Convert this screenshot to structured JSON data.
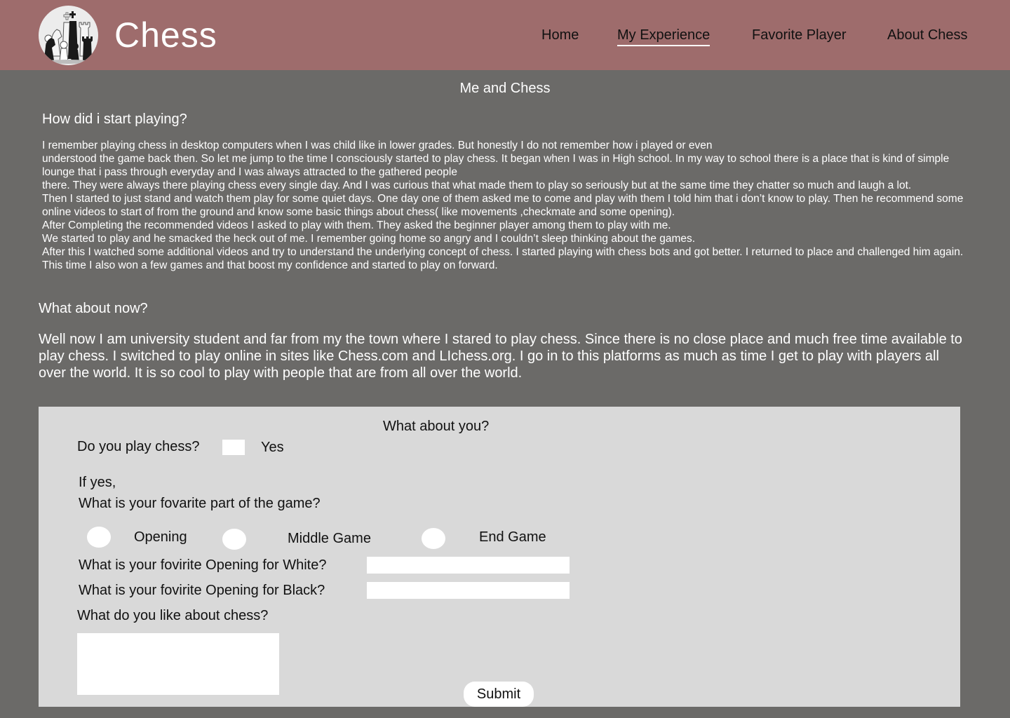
{
  "header": {
    "brand": "Chess",
    "nav": [
      "Home",
      "My Experience",
      "Favorite Player",
      "About Chess"
    ],
    "active_nav": "My Experience",
    "logo_icon": "chess-pieces-icon"
  },
  "main": {
    "title": "Me and Chess",
    "start_heading": "How did i start playing?",
    "story_lines": [
      "I remember playing chess in desktop computers when I was child like in lower grades. But honestly I do not remember how i played or even",
      "understood the game back then. So let me jump to the time I consciously started to play chess. It began when I was in High school. In my way to school there is a place that is kind of simple lounge that i pass through everyday and I was always attracted to the gathered people",
      "there. They were always there playing chess every single day. And I was curious that what made them to play so seriously but at the same time they chatter so much and laugh a lot.",
      "Then I started to just stand and watch them play for some quiet days. One day one of them asked me to come and play with them I told him that i don’t know to play. Then he recommend some online videos to start of from the ground and know some basic things about chess( like movements ,checkmate and some opening).",
      "After Completing the recommended videos I asked to play with them. They asked the beginner player among them to play with me.",
      "We started to play and he smacked the heck out of me. I remember going home so angry and I couldn’t sleep thinking about the games.",
      "After this I watched some additional videos and try to understand the underlying concept of chess. I started playing with chess bots and got better. I returned to place and challenged him again. This time I also won a few games and that boost my confidence and started to play on forward."
    ],
    "now_heading": "What about now?",
    "now_text": "Well now I am university student and far from my the town where I stared to play chess. Since there is no close place and much free time available to play chess. I switched to play online in sites like Chess.com and LIchess.org. I go in to this platforms as much as time I get to play with players all over the world. It is so cool to play with people that are from all over the world."
  },
  "form": {
    "title": "What about you?",
    "play_question": "Do you play chess?",
    "yes_label": "Yes",
    "if_yes": "If yes,",
    "favorite_part_question": "What is your fovarite part of the game?",
    "parts": [
      "Opening",
      "Middle Game",
      "End Game"
    ],
    "white_opening_label": "What is your fovirite Opening for White?",
    "white_opening_value": "",
    "black_opening_label": "What is your fovirite Opening for Black?",
    "black_opening_value": "",
    "like_label": "What do you like about chess?",
    "like_value": "",
    "submit_label": "Submit"
  },
  "colors": {
    "background": "#6b6a68",
    "header": "#9e6c6c",
    "form_background": "#d9d9d9"
  }
}
